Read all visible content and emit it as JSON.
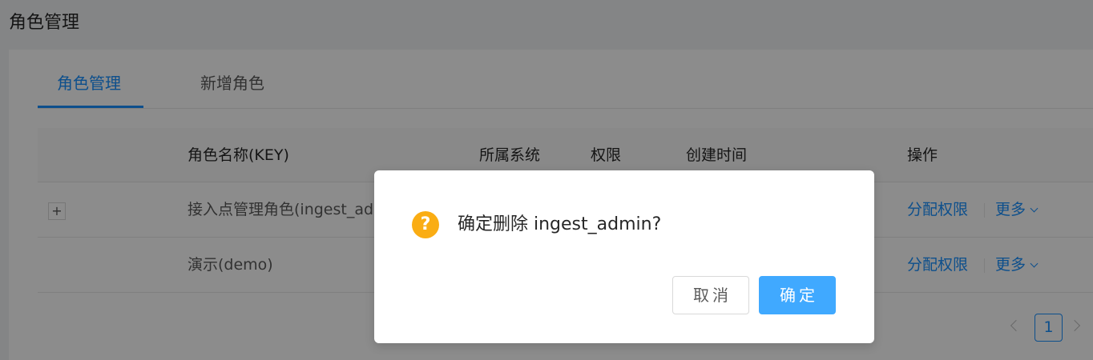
{
  "page": {
    "title": "角色管理"
  },
  "tabs": [
    {
      "label": "角色管理",
      "active": true
    },
    {
      "label": "新增角色",
      "active": false
    }
  ],
  "table": {
    "columns": [
      "角色名称(KEY)",
      "所属系统",
      "权限",
      "创建时间",
      "操作"
    ],
    "rows": [
      {
        "name": "接入点管理角色(ingest_admin)",
        "expand": "+",
        "actions": [
          "分配权限",
          "更多"
        ]
      },
      {
        "name": "演示(demo)",
        "expand": "",
        "actions": [
          "分配权限",
          "更多"
        ]
      }
    ]
  },
  "pagination": {
    "current": "1"
  },
  "modal": {
    "icon": "?",
    "title": "确定删除 ingest_admin?",
    "cancel_label": "取消",
    "ok_label": "确定"
  },
  "colors": {
    "primary": "#1890ff",
    "warning": "#faad14",
    "ok_button": "#40a9ff"
  }
}
